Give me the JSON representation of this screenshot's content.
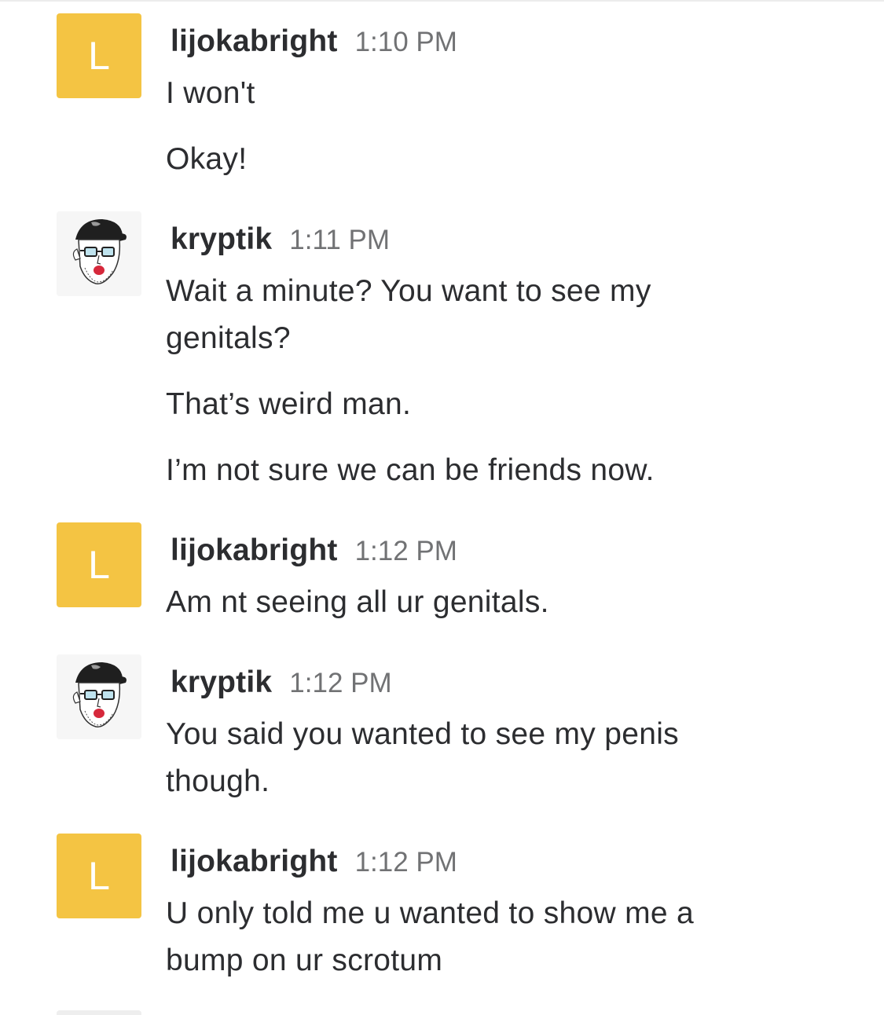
{
  "messages": [
    {
      "user": "lijokabright",
      "avatar_letter": "L",
      "avatar_color": "#f4c443",
      "time": "1:10 PM",
      "lines": [
        "I won't",
        "Okay!"
      ]
    },
    {
      "user": "kryptik",
      "avatar_icon": "user-avatar-photo",
      "time": "1:11 PM",
      "lines": [
        "Wait a minute? You want to see my",
        "genitals?",
        "That’s weird man.",
        "I’m not sure we can be friends now."
      ]
    },
    {
      "user": "lijokabright",
      "avatar_letter": "L",
      "avatar_color": "#f4c443",
      "time": "1:12 PM",
      "lines": [
        "Am nt seeing all ur genitals."
      ]
    },
    {
      "user": "kryptik",
      "avatar_icon": "user-avatar-photo",
      "time": "1:12 PM",
      "lines": [
        "You said you wanted to see my penis",
        "though."
      ]
    },
    {
      "user": "lijokabright",
      "avatar_letter": "L",
      "avatar_color": "#f4c443",
      "time": "1:12 PM",
      "lines": [
        "U only told me u wanted to show me a",
        "bump on ur scrotum"
      ]
    }
  ]
}
